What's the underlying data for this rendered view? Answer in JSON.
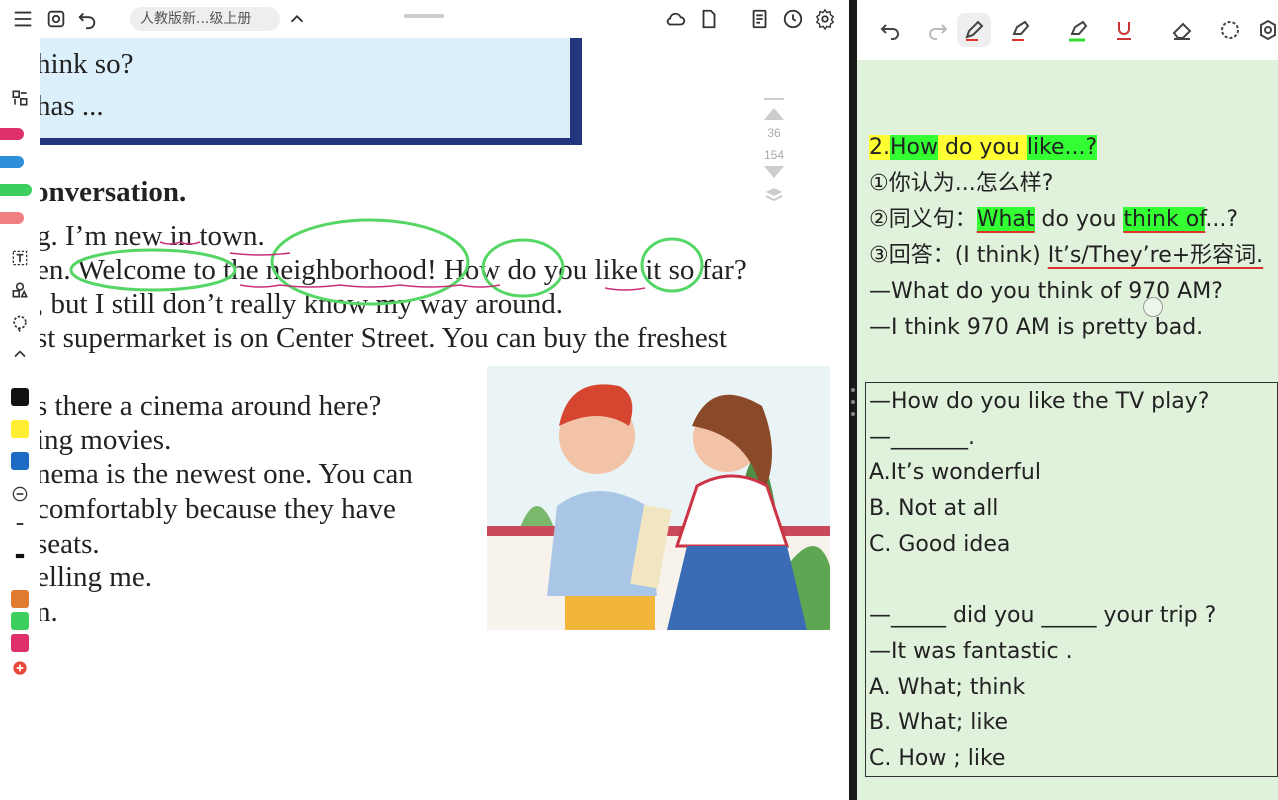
{
  "topbar": {
    "doc_title": "人教版新...级上册",
    "icons": [
      "menu-icon",
      "screenshot-icon",
      "undo-icon",
      "chevron-up-icon",
      "cloud-sync-icon",
      "page-icon",
      "notes-icon",
      "clock-icon",
      "settings-icon"
    ]
  },
  "side_tools": {
    "colors": [
      "#111111",
      "#ffee33",
      "#1a6bc4",
      "#e07a30",
      "#3ccf5e",
      "#e0306a"
    ]
  },
  "page": {
    "lines": [
      "hink so?",
      "has ...",
      "onversation.",
      "g. I’m new in town.",
      "en. Welcome to the neighborhood! How do you like it so far?",
      ", but I still don’t really know my way around.",
      "st supermarket is on Center Street. You can buy the freshest",
      "s there a cinema around here?",
      "ing movies.",
      "nema is the newest one. You can",
      " comfortably because they have",
      "seats.",
      "elling me.",
      "n."
    ],
    "page_current": "36",
    "page_total": "154"
  },
  "notes": {
    "heading_num": "2.",
    "heading_a": "How",
    "heading_b": " do you ",
    "heading_c": "like...?",
    "line1": "①你认为...怎么样?",
    "line2_a": "②同义句：",
    "line2_b": "What",
    "line2_c": " do you ",
    "line2_d": "think of",
    "line2_e": "...?",
    "line3_a": "③回答：(I think) ",
    "line3_b": "It’s/They’re+形容词.",
    "line4": "—What do you think of 970 AM?",
    "line5": "—I think 970 AM is pretty bad."
  },
  "quiz": {
    "lines": [
      "—How do you like the TV play?",
      "—_______.",
      "A.It’s wonderful",
      "B. Not at all",
      "C. Good idea",
      "",
      "—_____ did you _____ your trip ?",
      "—It was fantastic .",
      "A. What; think",
      "B. What; like",
      "C. How ; like"
    ]
  },
  "right_toolbar": {
    "icons": [
      "undo-icon",
      "redo-icon",
      "pen-icon",
      "highlighter-icon",
      "highlighter-green-icon",
      "underline-icon",
      "eraser-icon",
      "lasso-icon",
      "settings-icon"
    ]
  }
}
